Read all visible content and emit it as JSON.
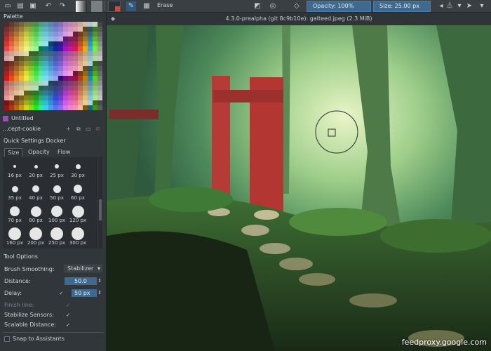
{
  "toolbar": {
    "blend_mode": "Erase",
    "opacity_label": "Opacity: 100%",
    "size_label": "Size: 25.00 px",
    "colors": {
      "foreground": "#2b2f3a",
      "background": "#c9ccd0"
    }
  },
  "palette_dock": {
    "title": "Palette",
    "palette_name": "Untitled",
    "preset_name": "...cept-cookie"
  },
  "quick_settings": {
    "title": "Quick Settings Docker",
    "tabs": [
      "Size",
      "Opacity",
      "Flow"
    ],
    "sizes": [
      {
        "label": "16 px",
        "d": 4
      },
      {
        "label": "20 px",
        "d": 5
      },
      {
        "label": "25 px",
        "d": 6
      },
      {
        "label": "30 px",
        "d": 7
      },
      {
        "label": "35 px",
        "d": 9
      },
      {
        "label": "40 px",
        "d": 10
      },
      {
        "label": "50 px",
        "d": 11
      },
      {
        "label": "60 px",
        "d": 12
      },
      {
        "label": "70 px",
        "d": 14
      },
      {
        "label": "80 px",
        "d": 15
      },
      {
        "label": "100 px",
        "d": 16
      },
      {
        "label": "120 px",
        "d": 17
      },
      {
        "label": "160 px",
        "d": 18
      },
      {
        "label": "200 px",
        "d": 18
      },
      {
        "label": "250 px",
        "d": 18
      },
      {
        "label": "300 px",
        "d": 18
      }
    ]
  },
  "tool_options": {
    "title": "Tool Options",
    "brush_smoothing_label": "Brush Smoothing:",
    "brush_smoothing_value": "Stabilizer",
    "distance_label": "Distance:",
    "distance_value": "50.0",
    "delay_label": "Delay:",
    "delay_value": "50 px",
    "finish_line_label": "Finish line:",
    "stabilize_sensors_label": "Stabilize Sensors:",
    "scalable_distance_label": "Scalable Distance:",
    "snap_label": "Snap to Assistants"
  },
  "canvas": {
    "title": "4.3.0-prealpha (git 8c9b10e): galteed.jpeg (2.3 MiB)"
  },
  "watermark": "feedproxy.google.com"
}
